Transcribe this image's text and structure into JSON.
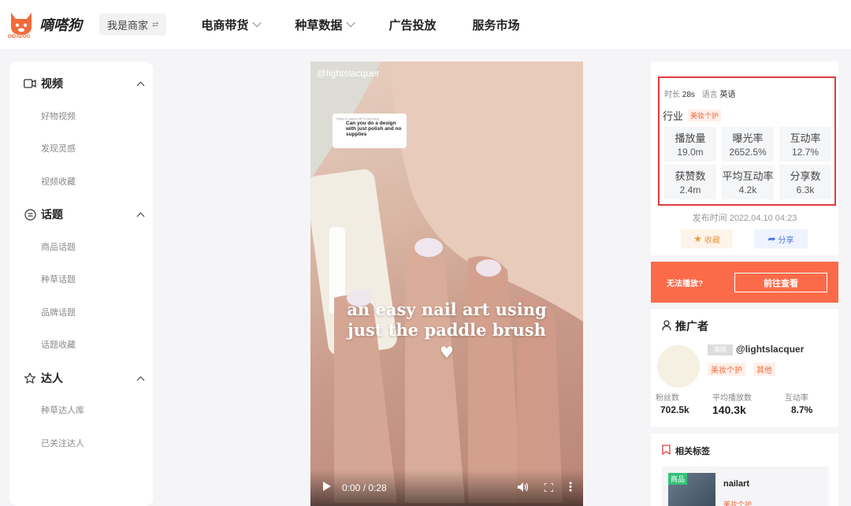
{
  "header": {
    "brand": "嘀嗒狗",
    "brand_sub": "DIDADOG",
    "merchant_label": "我是商家",
    "nav": [
      {
        "label": "电商带货"
      },
      {
        "label": "种草数据"
      },
      {
        "label": "广告投放"
      },
      {
        "label": "服务市场"
      }
    ]
  },
  "sidebar": {
    "sections": [
      {
        "label": "视频",
        "icon": "video-icon",
        "items": [
          "好物视频",
          "发现灵感",
          "视频收藏"
        ]
      },
      {
        "label": "话题",
        "icon": "topic-icon",
        "items": [
          "商品话题",
          "种草话题",
          "品牌话题",
          "话题收藏"
        ]
      },
      {
        "label": "达人",
        "icon": "star-icon",
        "items": [
          "种草达人库",
          "已关注达人"
        ]
      }
    ]
  },
  "video": {
    "handle": "@lightslacquer",
    "bubble_small": "Reply to ashlee.BP's comment",
    "bubble_question": "Can you do a design with just polish and no supplies",
    "caption_line1": "an easy nail art using",
    "caption_line2": "just the paddle brush",
    "time": "0:00 / 0:28"
  },
  "info": {
    "duration_label": "时长",
    "duration": "28s",
    "language_label": "语言",
    "language": "英语",
    "industry_label": "行业",
    "industry_tag": "美妆个护",
    "stats": [
      {
        "label": "播放量",
        "value": "19.0m"
      },
      {
        "label": "曝光率",
        "value": "2652.5%"
      },
      {
        "label": "互动率",
        "value": "12.7%"
      },
      {
        "label": "获赞数",
        "value": "2.4m"
      },
      {
        "label": "平均互动率",
        "value": "4.2k"
      },
      {
        "label": "分享数",
        "value": "6.3k"
      }
    ],
    "publish_time": "发布时间 2022.04.10 04:23",
    "fav_label": "收藏",
    "share_label": "分享"
  },
  "cannot_play": {
    "text": "无法播放?",
    "button": "前往查看"
  },
  "promoter": {
    "title": "推广者",
    "hidden_tag": "美国",
    "name": "@lightslacquer",
    "tags": [
      "美妆个护",
      "其他"
    ],
    "stats": [
      {
        "label": "粉丝数",
        "value": "702.5k"
      },
      {
        "label": "平均播放数",
        "value": "140.3k"
      },
      {
        "label": "互动率",
        "value": "8.7%"
      }
    ]
  },
  "related": {
    "title": "相关标签",
    "hot": "商品",
    "tag_name": "nailart",
    "tag_category": "美妆个护"
  },
  "colors": {
    "accent_orange": "#fb6b4a",
    "highlight_red": "#e43a3a"
  }
}
